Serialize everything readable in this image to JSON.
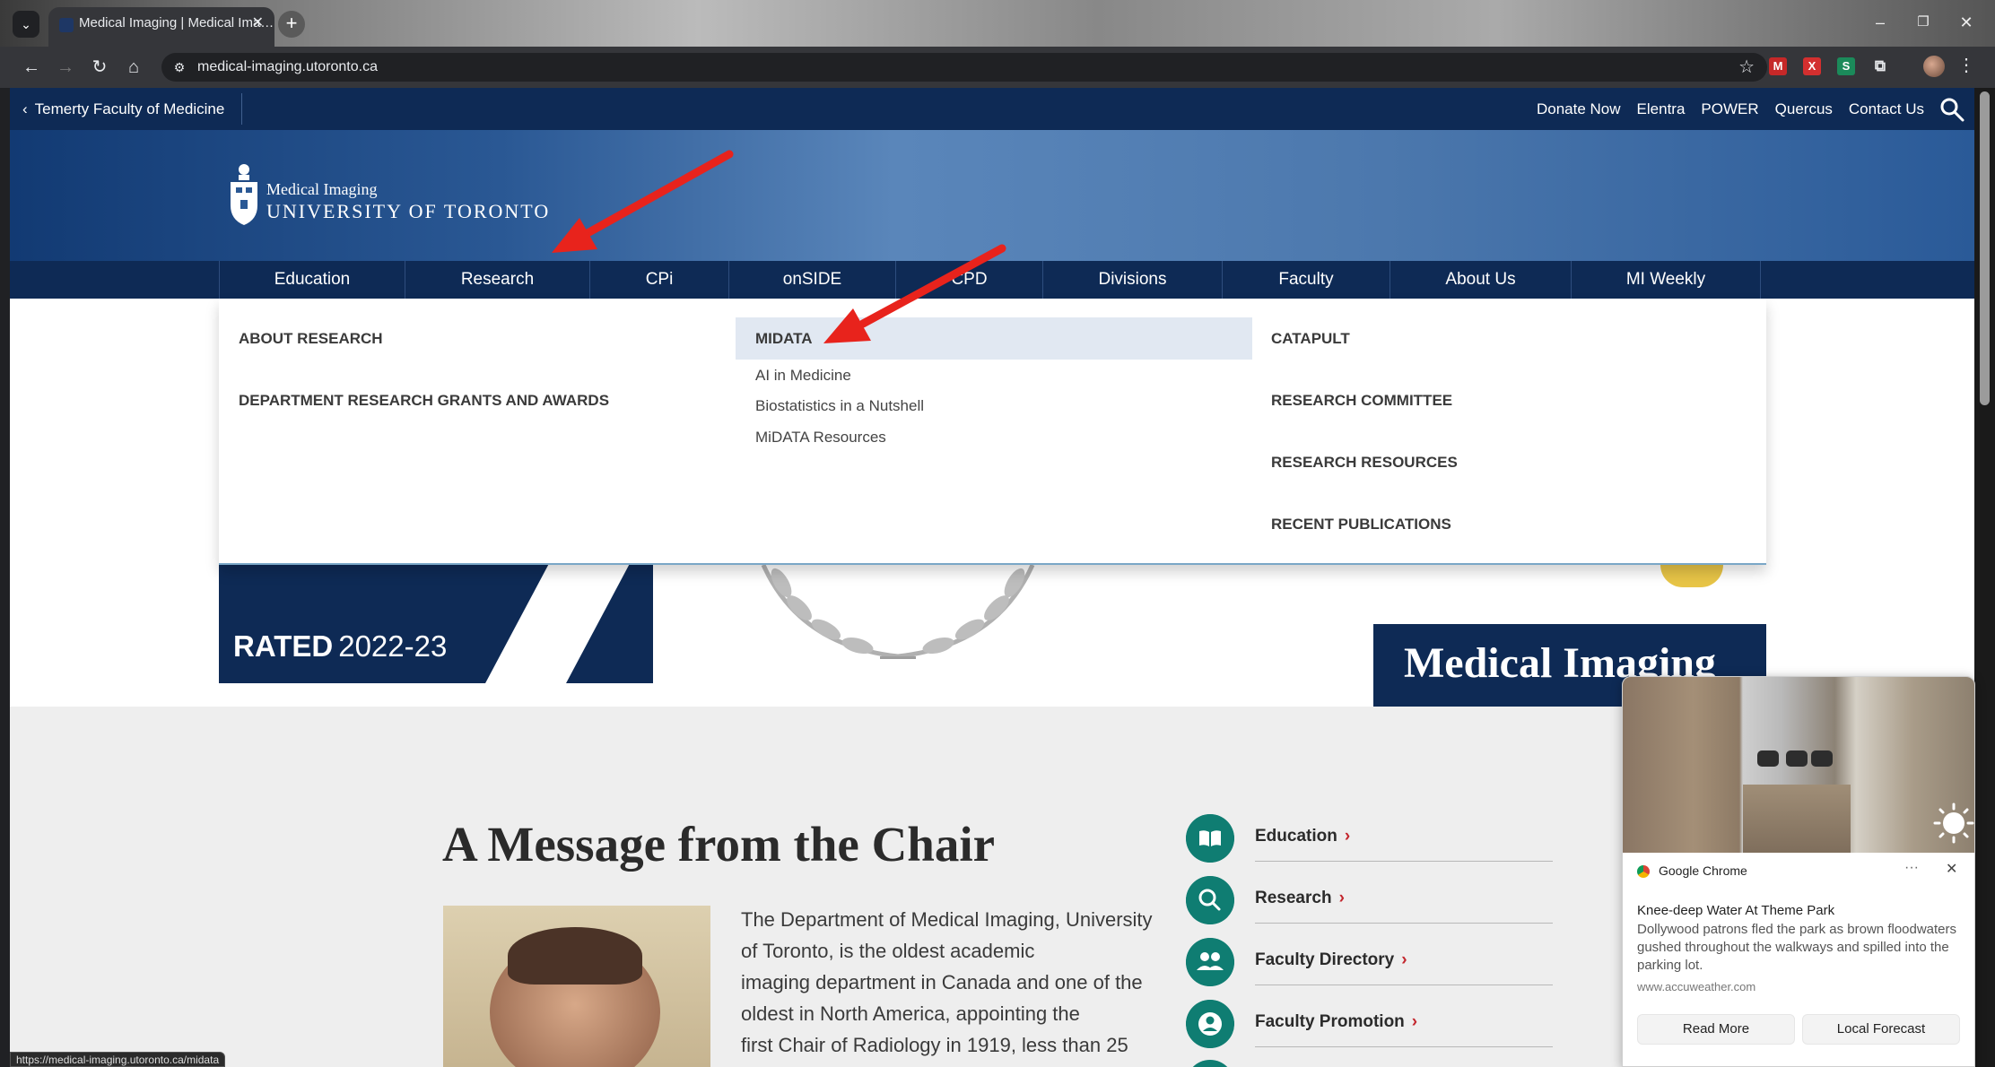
{
  "browser": {
    "tab_title": "Medical Imaging | Medical Ima…",
    "url": "medical-imaging.utoronto.ca",
    "status_url": "https://medical-imaging.utoronto.ca/midata"
  },
  "utility_bar": {
    "faculty_link": "Temerty Faculty of Medicine",
    "links": [
      "Donate Now",
      "Elentra",
      "POWER",
      "Quercus",
      "Contact Us"
    ]
  },
  "logo": {
    "line1": "Medical Imaging",
    "line2": "UNIVERSITY OF TORONTO"
  },
  "main_nav": [
    "Education",
    "Research",
    "CPi",
    "onSIDE",
    "CPD",
    "Divisions",
    "Faculty",
    "About Us",
    "MI Weekly"
  ],
  "mega_menu": {
    "col1": [
      "ABOUT RESEARCH",
      "DEPARTMENT RESEARCH GRANTS AND AWARDS"
    ],
    "col2_heading": "MIDATA",
    "col2_items": [
      "AI in Medicine",
      "Biostatistics in a Nutshell",
      "MiDATA Resources"
    ],
    "col3": [
      "CATAPULT",
      "RESEARCH COMMITTEE",
      "RESEARCH RESOURCES",
      "RECENT PUBLICATIONS"
    ]
  },
  "hero": {
    "rated_bold": "RATED",
    "rated_year": "2022-23",
    "mi_banner": "Medical Imaging"
  },
  "chair": {
    "title": "A Message from the Chair",
    "text_lines": [
      "The Department of Medical Imaging, University",
      "of Toronto, is the oldest academic",
      "imaging department in Canada and one of the",
      "oldest in North America, appointing the",
      "first Chair of Radiology in 1919, less than 25"
    ]
  },
  "quick_links": [
    {
      "label": "Education",
      "icon": "book-icon"
    },
    {
      "label": "Research",
      "icon": "search-icon"
    },
    {
      "label": "Faculty Directory",
      "icon": "people-icon"
    },
    {
      "label": "Faculty Promotion",
      "icon": "person-icon"
    }
  ],
  "notification": {
    "app": "Google Chrome",
    "title": "Knee-deep Water At Theme Park",
    "body": "Dollywood patrons fled the park as brown floodwaters gushed throughout the walkways and spilled into the parking lot.",
    "source": "www.accuweather.com",
    "button1": "Read More",
    "button2": "Local Forecast"
  },
  "colors": {
    "navy": "#0e2a55",
    "banner_blue": "#4c78ad",
    "teal": "#0f7d72",
    "accent_red": "#c3272e",
    "arrow_red": "#e8231c"
  }
}
